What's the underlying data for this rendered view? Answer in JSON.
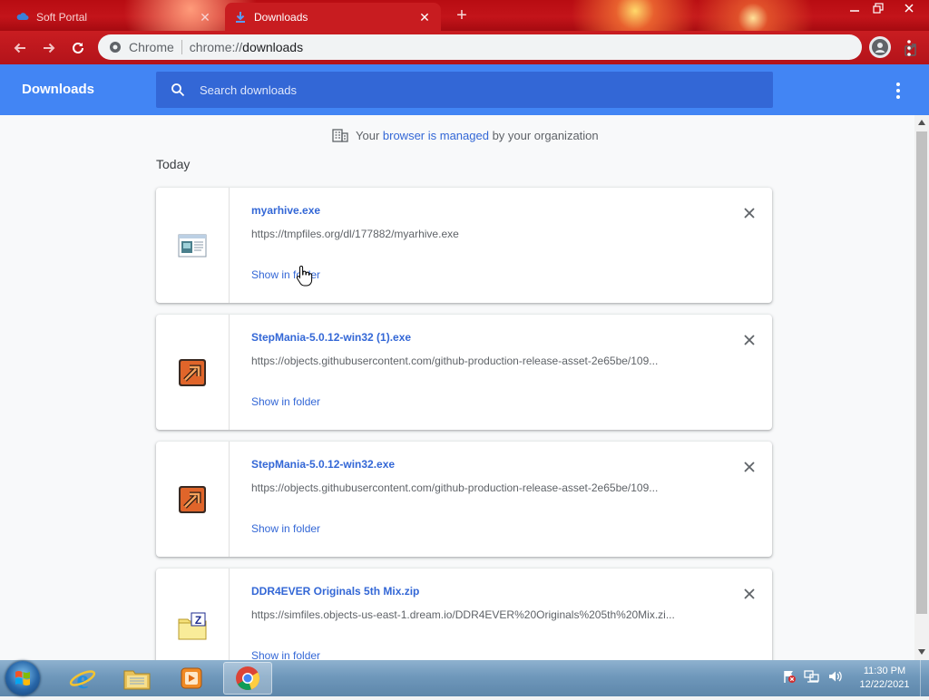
{
  "browser": {
    "tabs": [
      {
        "title": "Soft Portal",
        "active": false
      },
      {
        "title": "Downloads",
        "active": true
      }
    ],
    "omnibox": {
      "chip": "Chrome",
      "url_scheme": "chrome://",
      "url_host": "downloads"
    }
  },
  "downloads": {
    "title": "Downloads",
    "search_placeholder": "Search downloads",
    "managed": {
      "prefix": "Your ",
      "link": "browser is managed",
      "suffix": " by your organization"
    },
    "section": "Today",
    "items": [
      {
        "name": "myarhive.exe",
        "url": "https://tmpfiles.org/dl/177882/myarhive.exe",
        "action": "Show in folder",
        "icon": "exe-window-icon"
      },
      {
        "name": "StepMania-5.0.12-win32 (1).exe",
        "url": "https://objects.githubusercontent.com/github-production-release-asset-2e65be/109...",
        "action": "Show in folder",
        "icon": "stepmania-icon"
      },
      {
        "name": "StepMania-5.0.12-win32.exe",
        "url": "https://objects.githubusercontent.com/github-production-release-asset-2e65be/109...",
        "action": "Show in folder",
        "icon": "stepmania-icon"
      },
      {
        "name": "DDR4EVER Originals 5th Mix.zip",
        "url": "https://simfiles.objects-us-east-1.dream.io/DDR4EVER%20Originals%205th%20Mix.zi...",
        "action": "Show in folder",
        "icon": "zip-folder-icon"
      }
    ]
  },
  "taskbar": {
    "clock_time": "11:30 PM",
    "clock_date": "12/22/2021"
  },
  "colors": {
    "accent": "#4285f4",
    "search_bg": "#3367d6",
    "link": "#3367d6",
    "frame_red": "#c3141a"
  }
}
